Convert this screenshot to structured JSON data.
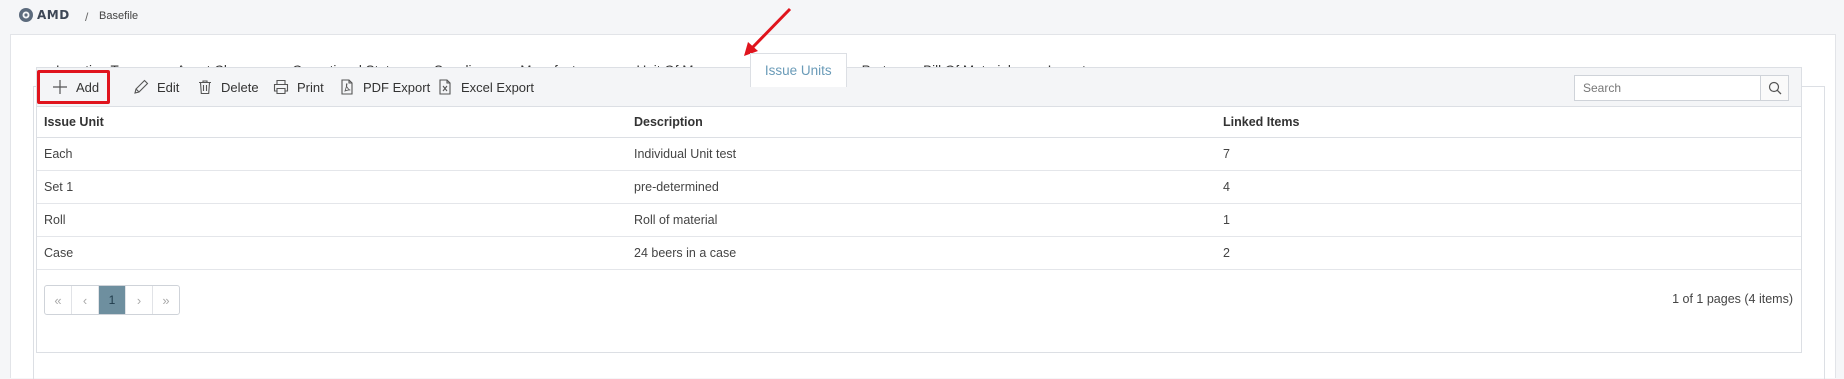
{
  "app": {
    "logo_text": "AMD",
    "breadcrumb": "Basefile"
  },
  "tabs": [
    {
      "label": "Location Types"
    },
    {
      "label": "Asset Classes"
    },
    {
      "label": "Operational Status"
    },
    {
      "label": "Suppliers"
    },
    {
      "label": "Manufacturers"
    },
    {
      "label": "Unit Of Measure"
    },
    {
      "label": "Issue Units"
    },
    {
      "label": "Parts"
    },
    {
      "label": "Bill Of Materials"
    },
    {
      "label": "Imports"
    }
  ],
  "active_tab": "Issue Units",
  "toolbar": {
    "add_label": "Add",
    "edit_label": "Edit",
    "delete_label": "Delete",
    "print_label": "Print",
    "pdf_label": "PDF Export",
    "excel_label": "Excel Export",
    "search_placeholder": "Search"
  },
  "table": {
    "columns": [
      "Issue Unit",
      "Description",
      "Linked Items"
    ],
    "rows": [
      [
        "Each",
        "Individual Unit test",
        "7"
      ],
      [
        "Set 1",
        "pre-determined",
        "4"
      ],
      [
        "Roll",
        "Roll of material",
        "1"
      ],
      [
        "Case",
        "24 beers in a case",
        "2"
      ]
    ]
  },
  "pager": {
    "first": "«",
    "prev": "‹",
    "current": "1",
    "next": "›",
    "last": "»",
    "info": "1 of 1 pages (4 items)"
  },
  "colors": {
    "accent": "#6a9bb8",
    "highlight": "#e0141d",
    "pager_active": "#6e8f9f"
  }
}
